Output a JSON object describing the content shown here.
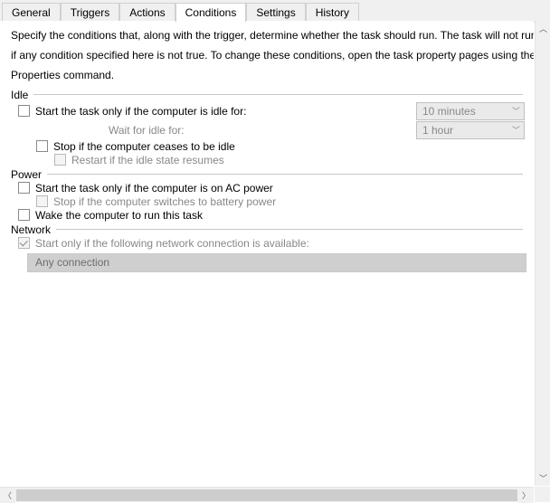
{
  "tabs": {
    "general": "General",
    "triggers": "Triggers",
    "actions": "Actions",
    "conditions": "Conditions",
    "settings": "Settings",
    "history": "History"
  },
  "intro_lines": [
    "Specify the conditions that, along with the trigger, determine whether the task should run.  The task will not run",
    "if any condition specified here is not true.  To change these conditions, open the task property pages using the",
    "Properties command."
  ],
  "idle": {
    "header": "Idle",
    "start_if_idle": "Start the task only if the computer is idle for:",
    "idle_duration": "10 minutes",
    "wait_for_idle": "Wait for idle for:",
    "wait_duration": "1 hour",
    "stop_if_not_idle": "Stop if the computer ceases to be idle",
    "restart_if_idle": "Restart if the idle state resumes"
  },
  "power": {
    "header": "Power",
    "start_on_ac": "Start the task only if the computer is on AC power",
    "stop_on_battery": "Stop if the computer switches to battery power",
    "wake": "Wake the computer to run this task"
  },
  "network": {
    "header": "Network",
    "start_if_network": "Start only if the following network connection is available:",
    "connection": "Any connection"
  }
}
